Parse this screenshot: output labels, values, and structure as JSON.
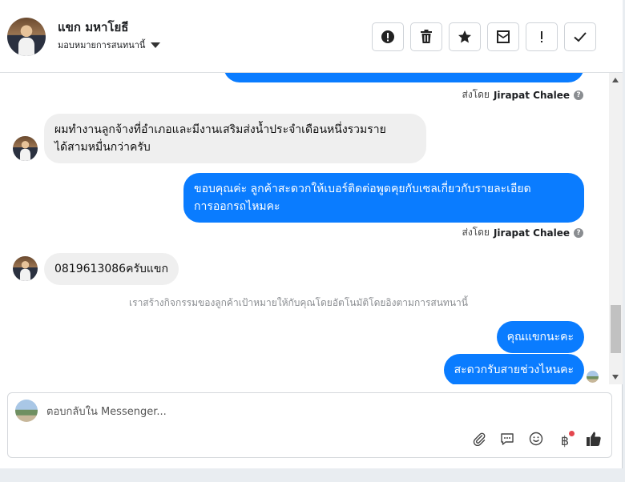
{
  "header": {
    "name": "แขก มหาโยธี",
    "subtitle": "มอบหมายการสนทนานี้",
    "buttons": [
      {
        "name": "spam-button",
        "icon": "alert-circle-icon"
      },
      {
        "name": "delete-button",
        "icon": "trash-icon"
      },
      {
        "name": "star-button",
        "icon": "star-icon"
      },
      {
        "name": "mark-unread-button",
        "icon": "envelope-icon"
      },
      {
        "name": "follow-up-button",
        "icon": "exclamation-icon"
      },
      {
        "name": "done-button",
        "icon": "check-icon"
      }
    ]
  },
  "messages": {
    "sent_by_label": "ส่งโดย",
    "sender": "Jirapat Chalee",
    "m1": "ผมทำงานลูกจ้างที่อำเภอและมีงานเสริมส่งน้ำประจำเดือนหนึ่งรวมราย",
    "m1b": "ได้สามหมื่นกว่าครับ",
    "m2": "ขอบคุณค่ะ ลูกค้าสะดวกให้เบอร์ติดต่อพูดคุยกับเซลเกี่ยวกับรายละเอียด",
    "m2b": "การออกรถไหมคะ",
    "m3": "0819613086ครับแขก",
    "system": "เราสร้างกิจกรรมของลูกค้าเป้าหมายให้กับคุณโดยอัตโนมัติโดยอิงตามการสนทนานี้",
    "m4": "คุณแขกนะคะ",
    "m5": "สะดวกรับสายช่วงไหนคะ"
  },
  "composer": {
    "placeholder": "ตอบกลับใน Messenger...",
    "tools": [
      "paperclip-icon",
      "comment-icon",
      "emoji-icon",
      "baht-icon",
      "thumbs-up-icon"
    ],
    "baht": "฿"
  },
  "colors": {
    "outgoing": "#0a7cff",
    "incoming": "#efefef",
    "notification": "#e4474e"
  }
}
